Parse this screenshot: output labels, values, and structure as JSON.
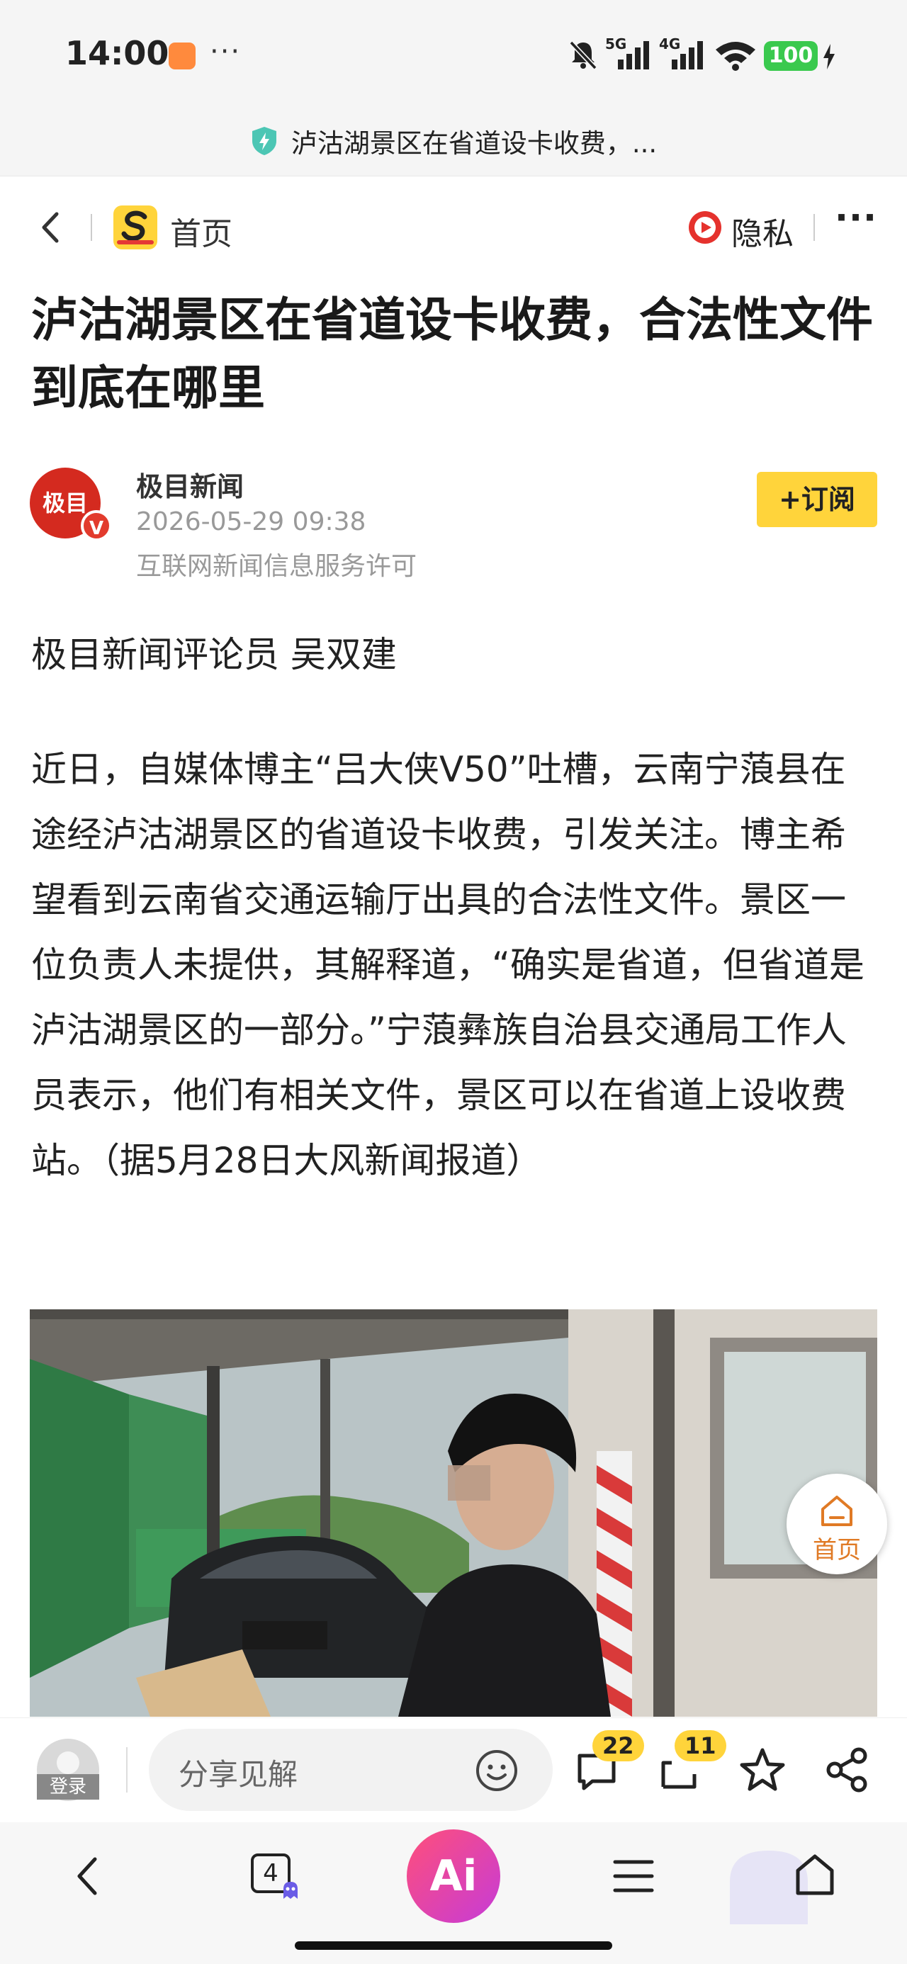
{
  "status_bar": {
    "time": "14:00",
    "more": "···",
    "net1": "5G",
    "net2": "4G",
    "battery": "100"
  },
  "url_bar": {
    "title": "泸沽湖景区在省道设卡收费，..."
  },
  "nav": {
    "home_label": "首页",
    "privacy_label": "隐私",
    "more": "···"
  },
  "article": {
    "title": "泸沽湖景区在省道设卡收费，合法性文件到底在哪里",
    "author": {
      "avatar_text": "极目",
      "verify": "V",
      "name": "极目新闻",
      "date": "2026-05-29 09:38",
      "license": "互联网新闻信息服务许可",
      "subscribe_label": "+订阅"
    },
    "byline": "极目新闻评论员 吴双建",
    "paragraph": "近日，自媒体博主“吕大侠V50”吐槽，云南宁蒗县在途经泸沽湖景区的省道设卡收费，引发关注。博主希望看到云南省交通运输厅出具的合法性文件。景区一位负责人未提供，其解释道，“确实是省道，但省道是泸沽湖景区的一部分。”宁蒗彝族自治县交通局工作人员表示，他们有相关文件，景区可以在省道上设收费站。（据5月28日大风新闻报道）"
  },
  "floating": {
    "home_label": "首页"
  },
  "comment_bar": {
    "login_label": "登录",
    "share_placeholder": "分享见解",
    "comments_count": "22",
    "reposts_count": "11"
  },
  "navbar": {
    "tabs_count": "4",
    "ai_label": "Ai"
  },
  "colors": {
    "accent_yellow": "#ffd43b",
    "brand_red": "#d42a1f",
    "battery_green": "#3ac94e"
  }
}
